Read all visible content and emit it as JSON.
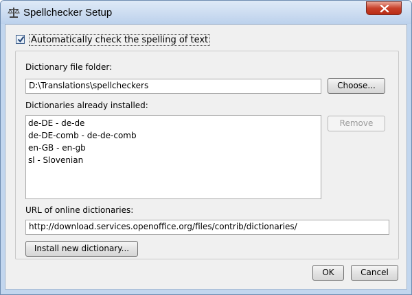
{
  "window": {
    "title": "Spellchecker Setup"
  },
  "auto_check": {
    "label": "Automatically check the spelling of text",
    "checked": true
  },
  "dictionary_folder": {
    "label": "Dictionary file folder:",
    "value": "D:\\Translations\\spellcheckers",
    "choose_label": "Choose..."
  },
  "installed": {
    "label": "Dictionaries already installed:",
    "items": [
      "de-DE - de-de",
      "de-DE-comb - de-de-comb",
      "en-GB - en-gb",
      "sl - Slovenian"
    ],
    "remove_label": "Remove"
  },
  "online": {
    "label": "URL of online dictionaries:",
    "value": "http://download.services.openoffice.org/files/contrib/dictionaries/",
    "install_label": "Install new dictionary..."
  },
  "footer": {
    "ok_label": "OK",
    "cancel_label": "Cancel"
  },
  "icons": {
    "app": "scale-icon",
    "close": "close-icon",
    "check": "check-icon"
  }
}
